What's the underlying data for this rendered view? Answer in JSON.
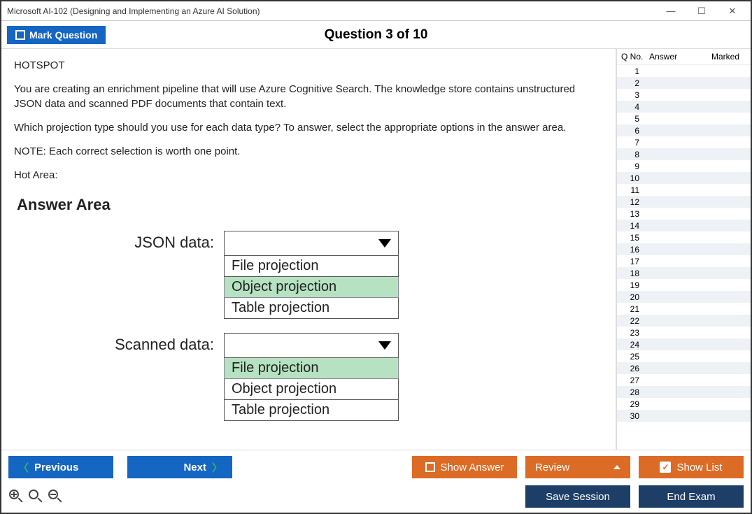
{
  "window_title": "Microsoft AI-102 (Designing and Implementing an Azure AI Solution)",
  "toolbar": {
    "mark_label": "Mark Question",
    "question_title": "Question 3 of 10"
  },
  "question": {
    "heading": "HOTSPOT",
    "p1": "You are creating an enrichment pipeline that will use Azure Cognitive Search. The knowledge store contains unstructured JSON data and scanned PDF documents that contain text.",
    "p2": "Which projection type should you use for each data type? To answer, select the appropriate options in the answer area.",
    "p3": "NOTE: Each correct selection is worth one point.",
    "p4": "Hot Area:",
    "answer_area_heading": "Answer Area",
    "hotspots": [
      {
        "label": "JSON data:",
        "options": [
          {
            "text": "File projection",
            "selected": false
          },
          {
            "text": "Object projection",
            "selected": true
          },
          {
            "text": "Table projection",
            "selected": false
          }
        ]
      },
      {
        "label": "Scanned data:",
        "options": [
          {
            "text": "File projection",
            "selected": true
          },
          {
            "text": "Object projection",
            "selected": false
          },
          {
            "text": "Table projection",
            "selected": false
          }
        ]
      }
    ]
  },
  "qlist": {
    "h1": "Q No.",
    "h2": "Answer",
    "h3": "Marked",
    "count": 30
  },
  "footer": {
    "previous": "Previous",
    "next": "Next",
    "show_answer": "Show Answer",
    "review": "Review",
    "show_list": "Show List",
    "save_session": "Save Session",
    "end_exam": "End Exam"
  }
}
